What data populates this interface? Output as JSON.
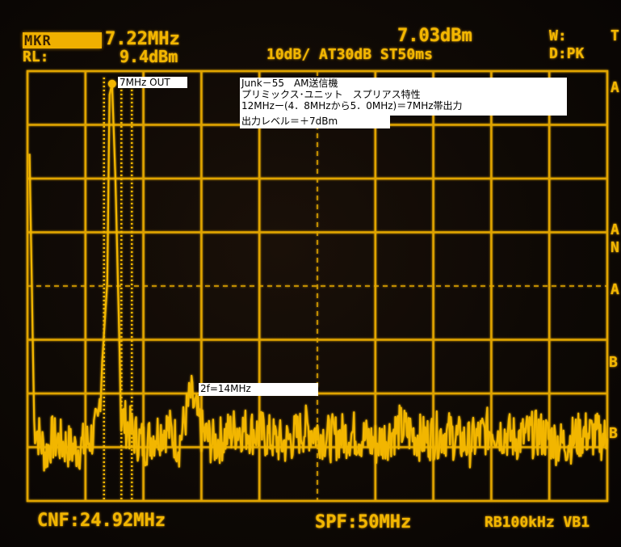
{
  "header": {
    "marker_label": "MKR",
    "marker_freq": "7.22MHz",
    "marker_level": "7.03dBm",
    "ref_label": "RL:",
    "ref_level": "9.4dBm",
    "settings": "10dB/ AT30dB ST50ms",
    "mode_w": "W:",
    "mode_d": "D:PK",
    "edge_t": "T"
  },
  "side_labels": [
    "A",
    "A",
    "N",
    "A",
    "B",
    "B"
  ],
  "footer": {
    "center": "CNF:24.92MHz",
    "span": "SPF:50MHz",
    "rbw": "RB100kHz VB1"
  },
  "annotations": {
    "marker_tag": "7MHz OUT",
    "title_lines": [
      "Junk－55　AM送信機",
      "プリミックス･ユニット　スプリアス特性",
      "12MHzー(4．8MHzから5．0MHz)＝7MHz帯出力",
      "出力レベル＝＋7dBm"
    ],
    "harmonic_tag": "2f=14MHz"
  },
  "colors": {
    "trace": "#f2b600",
    "grid": "#e0a400",
    "background": "#0e0905"
  },
  "chart_data": {
    "type": "line",
    "title": "",
    "xlabel": "",
    "ylabel": "",
    "center_frequency_MHz": 24.92,
    "span_MHz": 50,
    "reference_level_dBm": 9.4,
    "scale_dB_per_div": 10,
    "xlim_MHz": [
      -0.08,
      49.92
    ],
    "ylim_dBm": [
      -70.6,
      9.4
    ],
    "grid": true,
    "series": [
      {
        "x_MHz": [
          0.1,
          0.5,
          1.0,
          1.5,
          2.0,
          3.0,
          4.0,
          5.0,
          6.0,
          6.8,
          7.0,
          7.22,
          7.5,
          8.0,
          9.0,
          10.0,
          11.0,
          12.0,
          13.0,
          14.0,
          15.0,
          16.0,
          18.0,
          20.0,
          22.0,
          24.0,
          26.0,
          28.0,
          30.0,
          32.0,
          34.0,
          36.0,
          38.0,
          40.0,
          42.0,
          44.0,
          46.0,
          48.0,
          49.9
        ],
        "y_dBm": [
          -6,
          -56,
          -59,
          -62,
          -59,
          -60,
          -61,
          -60,
          -57,
          -30,
          5,
          7,
          -10,
          -55,
          -58,
          -60,
          -58,
          -57,
          -60,
          -51,
          -58,
          -60,
          -57,
          -58,
          -60,
          -57,
          -59,
          -58,
          -60,
          -57,
          -59,
          -58,
          -60,
          -57,
          -59,
          -58,
          -60,
          -58,
          -59
        ]
      }
    ],
    "marker": {
      "x_MHz": 7.22,
      "y_dBm": 7.03
    }
  }
}
